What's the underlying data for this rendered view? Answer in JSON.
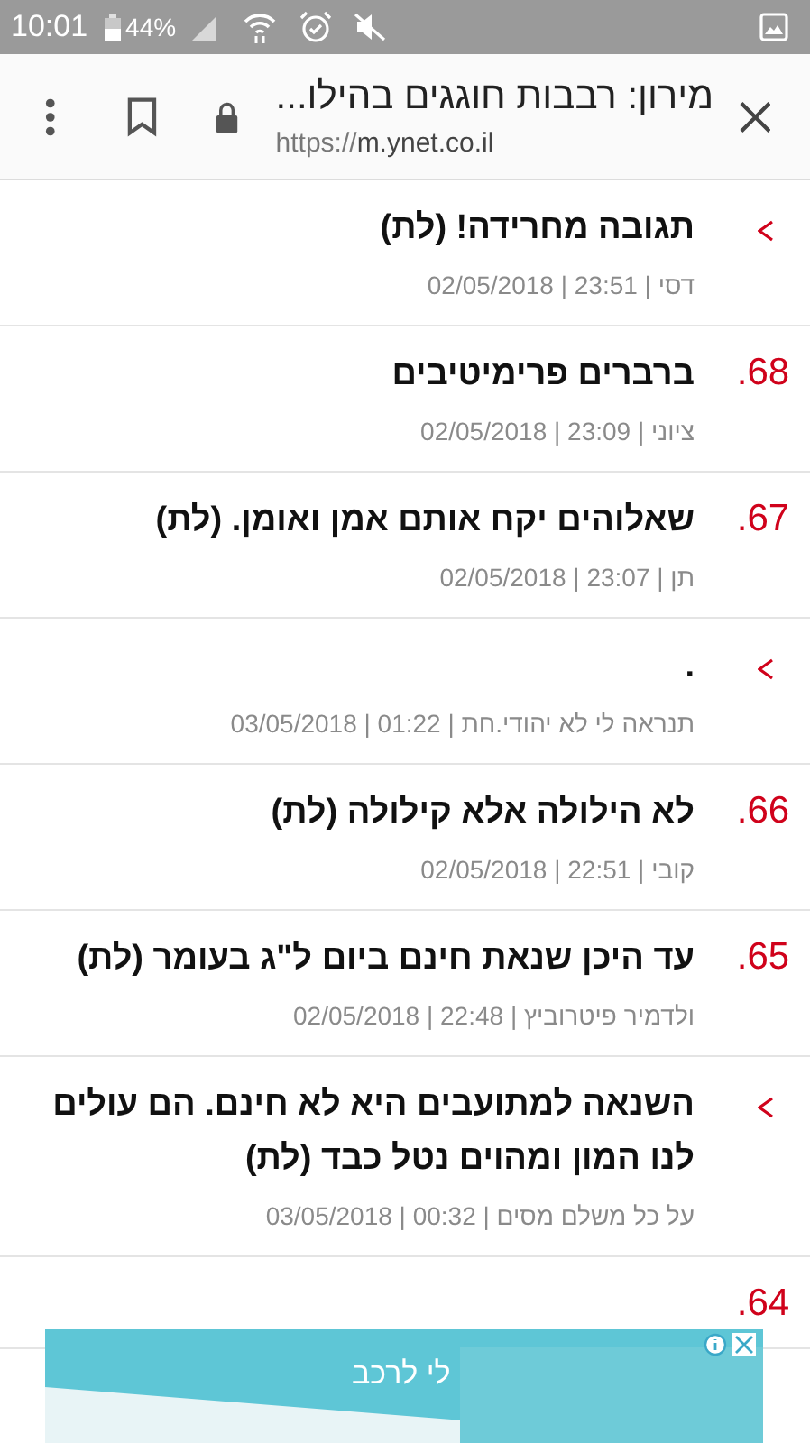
{
  "status_bar": {
    "time": "10:01",
    "battery": "44%"
  },
  "toolbar": {
    "title": "מירון: רבבות חוגגים בהילו...",
    "url_prefix": "https://",
    "url_host": "m.ynet.co.il"
  },
  "comments": [
    {
      "kind": "reply",
      "title": "תגובה מחרידה! (לת)",
      "meta": "דסי | 23:51 | 02/05/2018"
    },
    {
      "kind": "numbered",
      "number": "68.",
      "title": "ברברים פרימיטיבים",
      "meta": "ציוני | 23:09 | 02/05/2018"
    },
    {
      "kind": "numbered",
      "number": "67.",
      "title": "שאלוהים יקח אותם אמן ואומן. (לת)",
      "meta": "תן | 23:07 | 02/05/2018"
    },
    {
      "kind": "reply",
      "title": ".",
      "meta": "תנראה לי לא יהודי.חת | 01:22 | 03/05/2018"
    },
    {
      "kind": "numbered",
      "number": "66.",
      "title": "לא הילולה אלא קילולה (לת)",
      "meta": "קובי | 22:51 | 02/05/2018"
    },
    {
      "kind": "numbered",
      "number": "65.",
      "title": "עד היכן שנאת חינם ביום ל\"ג בעומר (לת)",
      "meta": "ולדמיר פיטרוביץ | 22:48 | 02/05/2018"
    },
    {
      "kind": "reply",
      "title": "השנאה למתועבים היא לא חינם. הם עולים לנו המון ומהוים נטל כבד (לת)",
      "meta": "על כל משלם מסים | 00:32 | 03/05/2018"
    },
    {
      "kind": "numbered",
      "number": "64."
    }
  ],
  "ad": {
    "text": "לי לרכב"
  }
}
